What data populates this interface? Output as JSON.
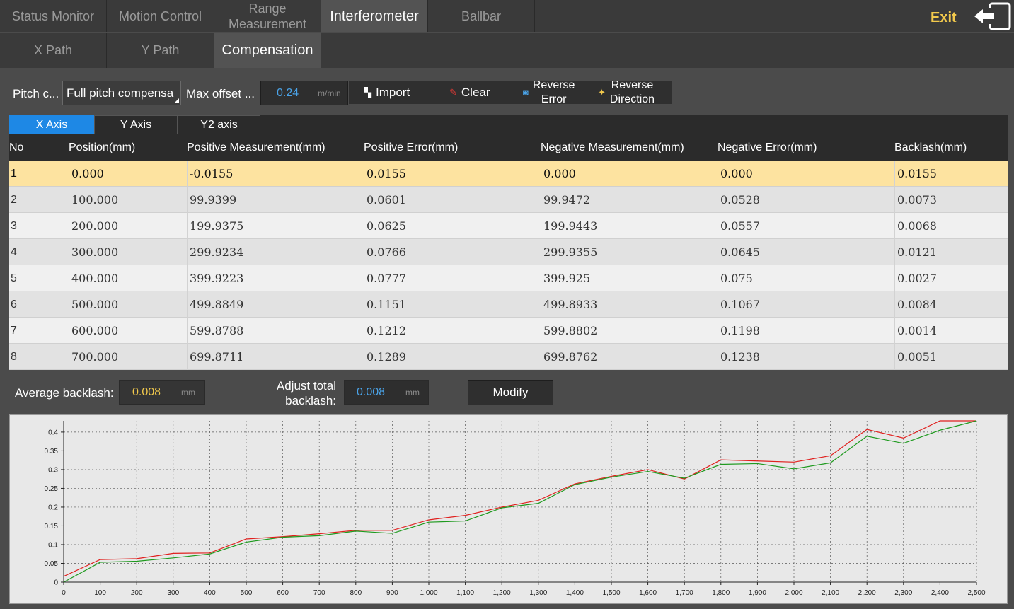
{
  "top_tabs": [
    {
      "label": "Status Monitor",
      "active": false
    },
    {
      "label": "Motion Control",
      "active": false
    },
    {
      "label": "Range\nMeasurement",
      "active": false
    },
    {
      "label": "Interferometer",
      "active": true
    },
    {
      "label": "Ballbar",
      "active": false
    }
  ],
  "exit_label": "Exit",
  "sub_tabs": [
    {
      "label": "X Path",
      "active": false
    },
    {
      "label": "Y Path",
      "active": false
    },
    {
      "label": "Compensation",
      "active": true
    }
  ],
  "controls": {
    "pitch_label": "Pitch c...",
    "pitch_value": "Full pitch compensa",
    "max_offset_label": "Max offset ...",
    "max_offset_value": "0.24",
    "max_offset_unit": "m/min",
    "import_label": "Import",
    "clear_label": "Clear",
    "reverse_error_label": "Reverse\nError",
    "reverse_direction_label": "Reverse\nDirection"
  },
  "axis_tabs": [
    {
      "label": "X Axis",
      "active": true
    },
    {
      "label": "Y Axis",
      "active": false
    },
    {
      "label": "Y2 axis",
      "active": false
    }
  ],
  "table": {
    "columns": [
      "No",
      "Position(mm)",
      "Positive Measurement(mm)",
      "Positive Error(mm)",
      "Negative Measurement(mm)",
      "Negative Error(mm)",
      "Backlash(mm)"
    ],
    "rows": [
      [
        "1",
        "0.000",
        "-0.0155",
        "0.0155",
        "0.000",
        "0.000",
        "0.0155"
      ],
      [
        "2",
        "100.000",
        "99.9399",
        "0.0601",
        "99.9472",
        "0.0528",
        "0.0073"
      ],
      [
        "3",
        "200.000",
        "199.9375",
        "0.0625",
        "199.9443",
        "0.0557",
        "0.0068"
      ],
      [
        "4",
        "300.000",
        "299.9234",
        "0.0766",
        "299.9355",
        "0.0645",
        "0.0121"
      ],
      [
        "5",
        "400.000",
        "399.9223",
        "0.0777",
        "399.925",
        "0.075",
        "0.0027"
      ],
      [
        "6",
        "500.000",
        "499.8849",
        "0.1151",
        "499.8933",
        "0.1067",
        "0.0084"
      ],
      [
        "7",
        "600.000",
        "599.8788",
        "0.1212",
        "599.8802",
        "0.1198",
        "0.0014"
      ],
      [
        "8",
        "700.000",
        "699.8711",
        "0.1289",
        "699.8762",
        "0.1238",
        "0.0051"
      ]
    ],
    "selected_row": 0
  },
  "backlash": {
    "average_label": "Average backlash:",
    "average_value": "0.008",
    "average_unit": "mm",
    "adjust_label": "Adjust total\nbacklash:",
    "adjust_value": "0.008",
    "adjust_unit": "mm",
    "modify_label": "Modify"
  },
  "colors": {
    "accent": "#1e88e5",
    "selected_row": "#fde3a0",
    "exit": "#f2c94c",
    "series_positive": "#e0201e",
    "series_negative": "#1f9a1f"
  },
  "chart_data": {
    "type": "line",
    "xlim": [
      0,
      2500
    ],
    "ylim": [
      0,
      0.43
    ],
    "x_ticks": [
      0,
      100,
      200,
      300,
      400,
      500,
      600,
      700,
      800,
      900,
      1000,
      1100,
      1200,
      1300,
      1400,
      1500,
      1600,
      1700,
      1800,
      1900,
      2000,
      2100,
      2200,
      2300,
      2400,
      2500
    ],
    "x_tick_labels": [
      "0",
      "100",
      "200",
      "300",
      "400",
      "500",
      "600",
      "700",
      "800",
      "900",
      "1,000",
      "1,100",
      "1,200",
      "1,300",
      "1,400",
      "1,500",
      "1,600",
      "1,700",
      "1,800",
      "1,900",
      "2,000",
      "2,100",
      "2,200",
      "2,300",
      "2,400",
      "2,500"
    ],
    "y_ticks": [
      0,
      0.05,
      0.1,
      0.15,
      0.2,
      0.25,
      0.3,
      0.35,
      0.4
    ],
    "y_tick_labels": [
      "0",
      "0.05",
      "0.1",
      "0.15",
      "0.2",
      "0.25",
      "0.3",
      "0.35",
      "0.4"
    ],
    "grid": true,
    "x": [
      0,
      100,
      200,
      300,
      400,
      500,
      600,
      700,
      800,
      900,
      1000,
      1100,
      1200,
      1300,
      1400,
      1500,
      1600,
      1700,
      1800,
      1900,
      2000,
      2100,
      2200,
      2300,
      2400,
      2500
    ],
    "series": [
      {
        "color": "#e0201e",
        "values": [
          0.0155,
          0.0601,
          0.0625,
          0.0766,
          0.0777,
          0.1151,
          0.1212,
          0.1289,
          0.138,
          0.138,
          0.166,
          0.178,
          0.2,
          0.218,
          0.262,
          0.282,
          0.3,
          0.275,
          0.326,
          0.323,
          0.32,
          0.337,
          0.407,
          0.384,
          0.43,
          0.43
        ]
      },
      {
        "color": "#1f9a1f",
        "values": [
          0.0,
          0.0528,
          0.0557,
          0.0645,
          0.075,
          0.1067,
          0.1198,
          0.1238,
          0.136,
          0.13,
          0.16,
          0.163,
          0.198,
          0.21,
          0.26,
          0.28,
          0.295,
          0.277,
          0.314,
          0.316,
          0.302,
          0.318,
          0.389,
          0.37,
          0.405,
          0.43
        ]
      }
    ]
  }
}
